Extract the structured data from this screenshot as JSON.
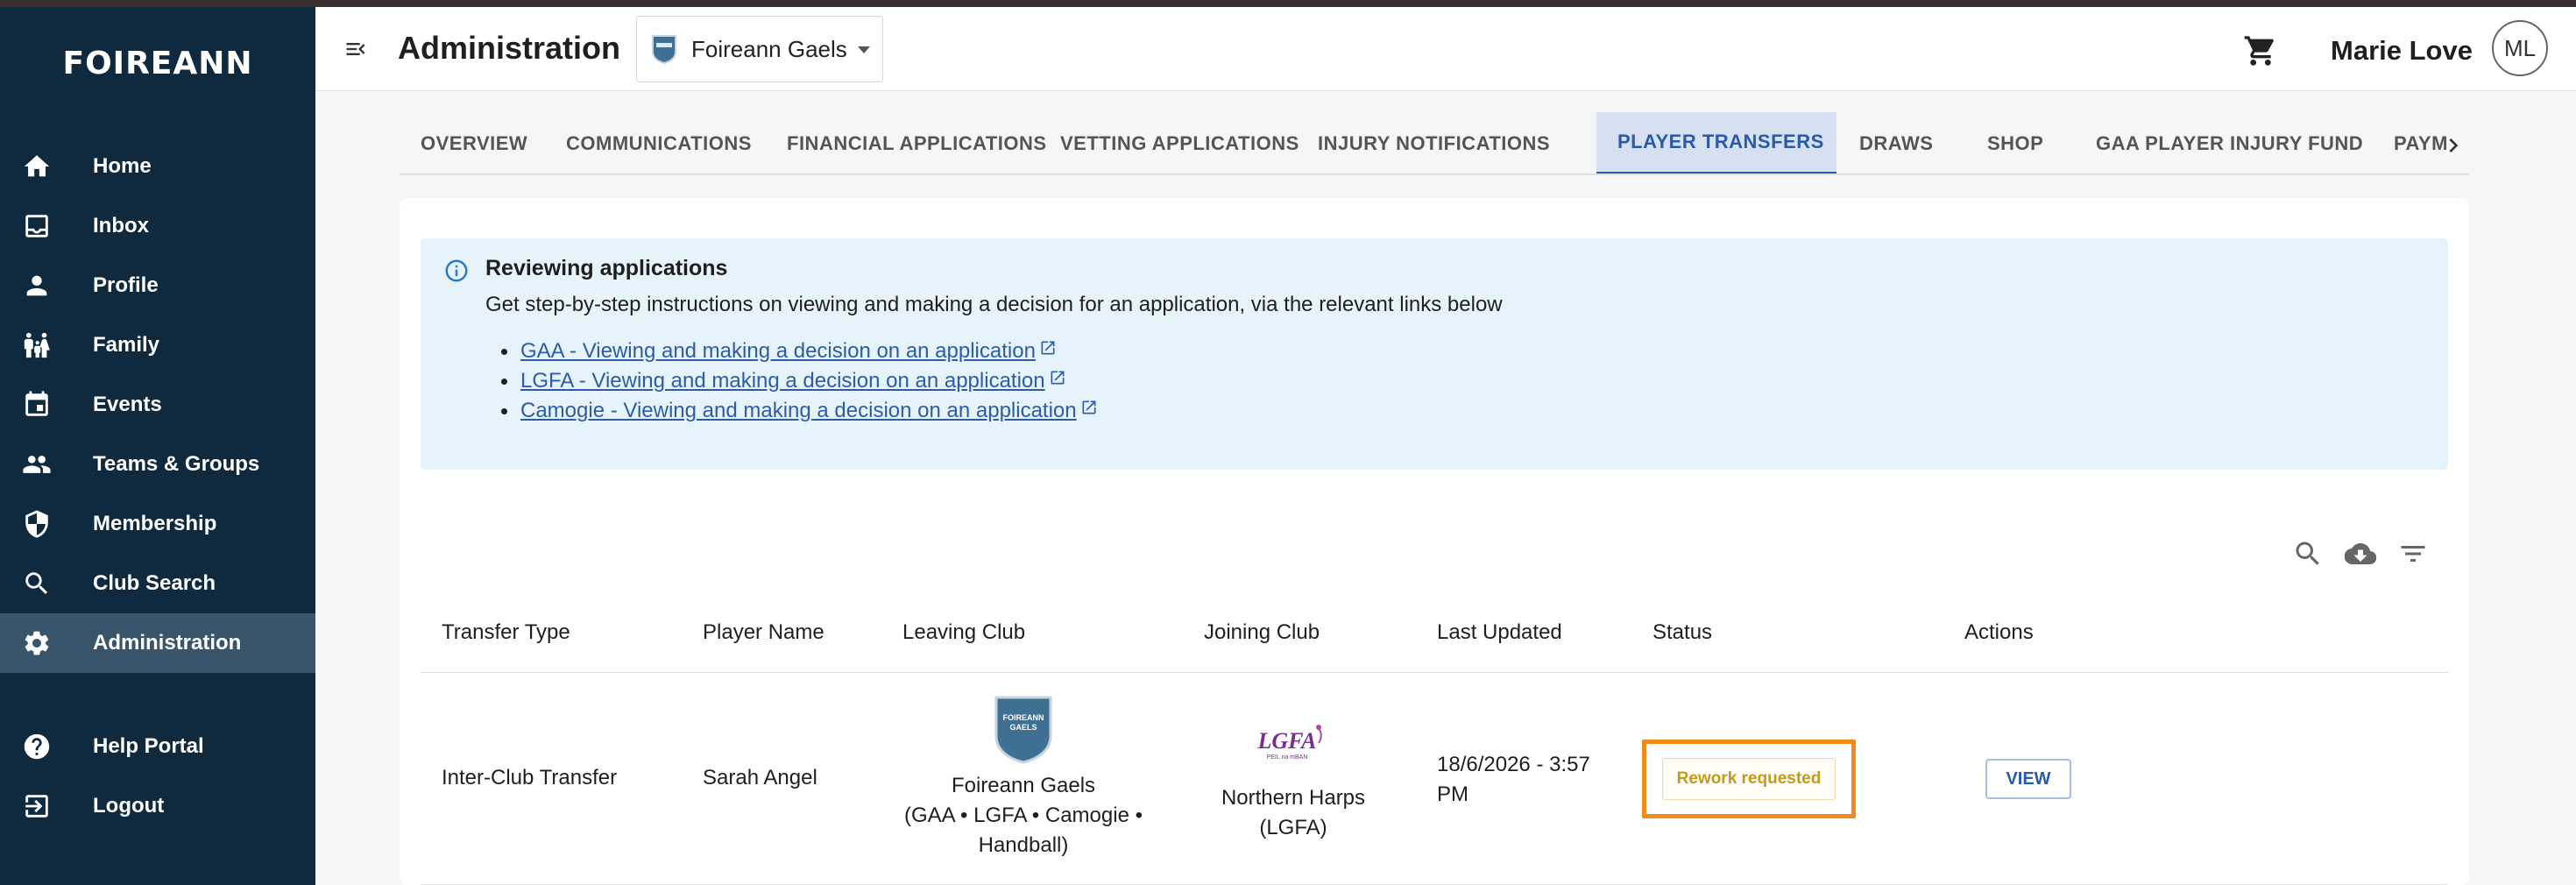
{
  "brand": {
    "logo_text": "FOIREANN"
  },
  "sidebar": {
    "items": [
      {
        "label": "Home",
        "icon": "home-icon"
      },
      {
        "label": "Inbox",
        "icon": "inbox-icon"
      },
      {
        "label": "Profile",
        "icon": "person-icon"
      },
      {
        "label": "Family",
        "icon": "family-icon"
      },
      {
        "label": "Events",
        "icon": "calendar-icon"
      },
      {
        "label": "Teams & Groups",
        "icon": "group-icon"
      },
      {
        "label": "Membership",
        "icon": "shield-icon"
      },
      {
        "label": "Club Search",
        "icon": "search-icon"
      },
      {
        "label": "Administration",
        "icon": "gear-icon",
        "active": true
      }
    ],
    "bottom_items": [
      {
        "label": "Help Portal",
        "icon": "help-icon"
      },
      {
        "label": "Logout",
        "icon": "logout-icon"
      }
    ]
  },
  "header": {
    "title": "Administration",
    "club_select": {
      "value": "Foireann Gaels",
      "crest_text": "FOIREANN GAELS"
    },
    "user_name": "Marie Love",
    "avatar_initials": "ML"
  },
  "tabs": [
    {
      "label": "OVERVIEW"
    },
    {
      "label": "COMMUNICATIONS"
    },
    {
      "label": "FINANCIAL APPLICATIONS"
    },
    {
      "label": "VETTING APPLICATIONS"
    },
    {
      "label": "INJURY NOTIFICATIONS"
    },
    {
      "label": "PLAYER TRANSFERS",
      "active": true
    },
    {
      "label": "DRAWS"
    },
    {
      "label": "SHOP"
    },
    {
      "label": "GAA PLAYER INJURY FUND"
    },
    {
      "label": "PAYM"
    }
  ],
  "info": {
    "title": "Reviewing applications",
    "text": "Get step-by-step instructions on viewing and making a decision for an application, via the relevant links below",
    "links": [
      "GAA - Viewing and making a decision on an application",
      "LGFA - Viewing and making a decision on an application",
      "Camogie - Viewing and making a decision on an application"
    ]
  },
  "table": {
    "columns": [
      "Transfer Type",
      "Player Name",
      "Leaving Club",
      "Joining Club",
      "Last Updated",
      "Status",
      "Actions"
    ],
    "rows": [
      {
        "transfer_type": "Inter-Club Transfer",
        "player_name": "Sarah Angel",
        "leaving_club_line1": "Foireann Gaels",
        "leaving_club_line2": "(GAA • LGFA • Camogie •",
        "leaving_club_line3": "Handball)",
        "leaving_crest_text": "FOIREANN GAELS",
        "joining_club_line1": "Northern Harps",
        "joining_club_line2": "(LGFA)",
        "joining_logo_text": "LGFA",
        "joining_logo_sub": "PEIL na mBAN",
        "last_updated_line1": "18/6/2026 - 3:57",
        "last_updated_line2": "PM",
        "status": "Rework requested",
        "action": "VIEW"
      }
    ]
  },
  "colors": {
    "sidebar_bg": "#0f2a3f",
    "sidebar_active": "#39556b",
    "accent": "#2b5aa8",
    "info_bg": "#e6f3fb",
    "status_text": "#c49a1a",
    "highlight_orange": "#f08a18"
  }
}
